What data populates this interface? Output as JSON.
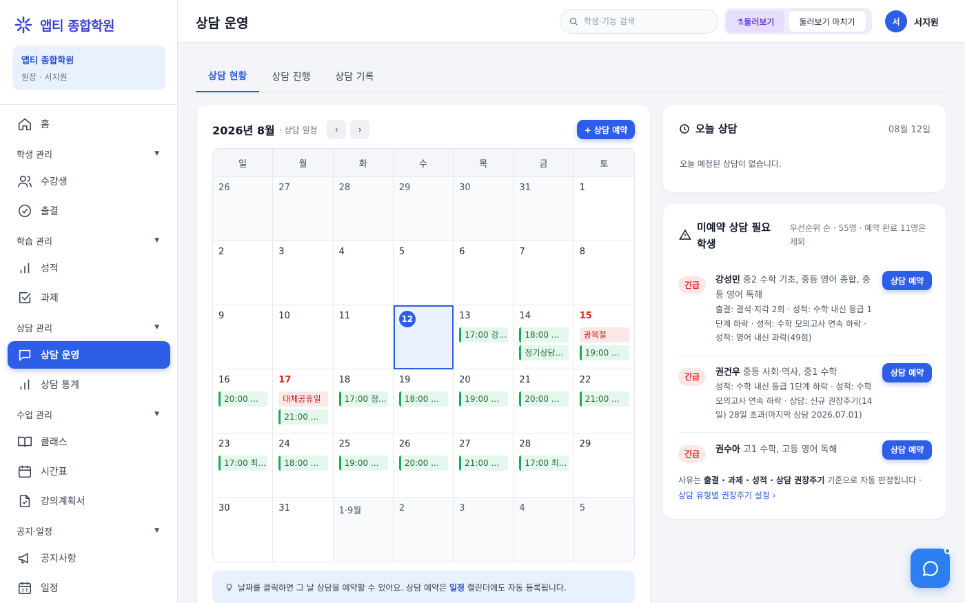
{
  "app": {
    "logo_text": "앱티 종합학원",
    "brand_color": "#3b3fd1",
    "accent_color": "#2d5ee8"
  },
  "profile": {
    "academy": "앱티 종합학원",
    "role": "원장 · 서지원"
  },
  "sidebar": {
    "home": "홈",
    "groups": [
      {
        "label": "학생 관리",
        "items": [
          {
            "label": "수강생",
            "icon": "users-icon"
          },
          {
            "label": "출결",
            "icon": "check-circle-icon"
          }
        ]
      },
      {
        "label": "학습 관리",
        "items": [
          {
            "label": "성적",
            "icon": "bar-chart-icon"
          },
          {
            "label": "과제",
            "icon": "checkbox-icon"
          }
        ]
      },
      {
        "label": "상담 관리",
        "items": [
          {
            "label": "상담 운영",
            "icon": "chat-icon",
            "active": true
          },
          {
            "label": "상담 통계",
            "icon": "bar-chart-icon"
          }
        ]
      },
      {
        "label": "수업 관리",
        "items": [
          {
            "label": "클래스",
            "icon": "book-icon"
          },
          {
            "label": "시간표",
            "icon": "calendar-icon"
          },
          {
            "label": "강의계획서",
            "icon": "document-check-icon"
          }
        ]
      },
      {
        "label": "공지·일정",
        "items": [
          {
            "label": "공지사항",
            "icon": "megaphone-icon"
          },
          {
            "label": "일정",
            "icon": "calendar-grid-icon"
          }
        ]
      }
    ]
  },
  "header": {
    "title": "상담 운영",
    "search_placeholder": "학생·기능 검색",
    "preview_label": "둘러보기",
    "preview_end_label": "둘러보기 마치기",
    "avatar_initial": "서",
    "user_name": "서지원"
  },
  "tabs": [
    "상담 현황",
    "상담 진행",
    "상담 기록"
  ],
  "calendar": {
    "title": "2026년 8월",
    "subtitle": "· 상담 일정",
    "prev_label": "‹",
    "next_label": "›",
    "book_button": "+ 상담 예약",
    "weekdays": [
      "일",
      "월",
      "화",
      "수",
      "목",
      "금",
      "토"
    ],
    "days": [
      {
        "label": "26",
        "other": true
      },
      {
        "label": "27",
        "other": true
      },
      {
        "label": "28",
        "other": true
      },
      {
        "label": "29",
        "other": true
      },
      {
        "label": "30",
        "other": true
      },
      {
        "label": "31",
        "other": true
      },
      {
        "label": "1"
      },
      {
        "label": "2"
      },
      {
        "label": "3"
      },
      {
        "label": "4"
      },
      {
        "label": "5"
      },
      {
        "label": "6"
      },
      {
        "label": "7"
      },
      {
        "label": "8"
      },
      {
        "label": "9"
      },
      {
        "label": "10"
      },
      {
        "label": "11"
      },
      {
        "label": "12",
        "today": true
      },
      {
        "label": "13",
        "events": [
          "17:00 강..."
        ]
      },
      {
        "label": "14",
        "events": [
          "18:00 ...",
          "정기상담..."
        ]
      },
      {
        "label": "15",
        "holiday": true,
        "holiday_name": "광복절",
        "events": [
          "19:00 ..."
        ]
      },
      {
        "label": "16",
        "events": [
          "20:00 ..."
        ]
      },
      {
        "label": "17",
        "holiday": true,
        "holiday_name": "대체공휴일",
        "events": [
          "21:00 ..."
        ]
      },
      {
        "label": "18",
        "events": [
          "17:00 정..."
        ]
      },
      {
        "label": "19",
        "events": [
          "18:00 ..."
        ]
      },
      {
        "label": "20",
        "events": [
          "19:00 ..."
        ]
      },
      {
        "label": "21",
        "events": [
          "20:00 ..."
        ]
      },
      {
        "label": "22",
        "events": [
          "21:00 ..."
        ]
      },
      {
        "label": "23",
        "events": [
          "17:00 최..."
        ]
      },
      {
        "label": "24",
        "events": [
          "18:00 ..."
        ]
      },
      {
        "label": "25",
        "events": [
          "19:00 ..."
        ]
      },
      {
        "label": "26",
        "events": [
          "20:00 ..."
        ]
      },
      {
        "label": "27",
        "events": [
          "21:00 ..."
        ]
      },
      {
        "label": "28",
        "events": [
          "17:00 최..."
        ]
      },
      {
        "label": "29"
      },
      {
        "label": "30"
      },
      {
        "label": "31"
      },
      {
        "label": "1·9월",
        "other": true
      },
      {
        "label": "2",
        "other": true
      },
      {
        "label": "3",
        "other": true
      },
      {
        "label": "4",
        "other": true
      },
      {
        "label": "5",
        "other": true
      }
    ],
    "tip_prefix": "날짜를 클릭하면 그 날 상담을 예약할 수 있어요. 상담 예약은",
    "tip_bold": "일정",
    "tip_suffix": "캘린더에도 자동 등록됩니다."
  },
  "today": {
    "title": "오늘 상담",
    "date": "08월 12일",
    "empty": "오늘 예정된 상담이 없습니다."
  },
  "pending": {
    "title": "미예약 상담 필요 학생",
    "meta": "우선순위 순 · 55명 · 예약 완료 11명은 제외",
    "items": [
      {
        "badge": "긴급",
        "name": "강성민",
        "classes": "중2 수학 기초, 중등 영어 종합, 중등 영어 독해",
        "reason": "출결: 결석·지각 2회 · 성적: 수학 내신 등급 1단계 하락 · 성적: 수학 모의고사 연속 하락 · 성적: 영어 내신 과락(49점)",
        "button": "상담 예약"
      },
      {
        "badge": "긴급",
        "name": "권건우",
        "classes": "중등 사회·역사, 중1 수학",
        "reason": "성적: 수학 내신 등급 1단계 하락 · 성적: 수학 모의고사 연속 하락 · 상담: 신규 권장주기(14일) 28일 초과(마지막 상담 2026.07.01)",
        "button": "상담 예약"
      },
      {
        "badge": "긴급",
        "name": "권수아",
        "classes": "고1 수학, 고등 영어 독해",
        "reason": "",
        "button": "상담 예약"
      }
    ],
    "foot_prefix": "사유는",
    "foot_bold": "출결 · 과제 · 성적 · 상담 권장주기",
    "foot_suffix": "기준으로 자동 판정됩니다 ·",
    "foot_link": "상담 유형별 권장주기 설정 ›"
  }
}
